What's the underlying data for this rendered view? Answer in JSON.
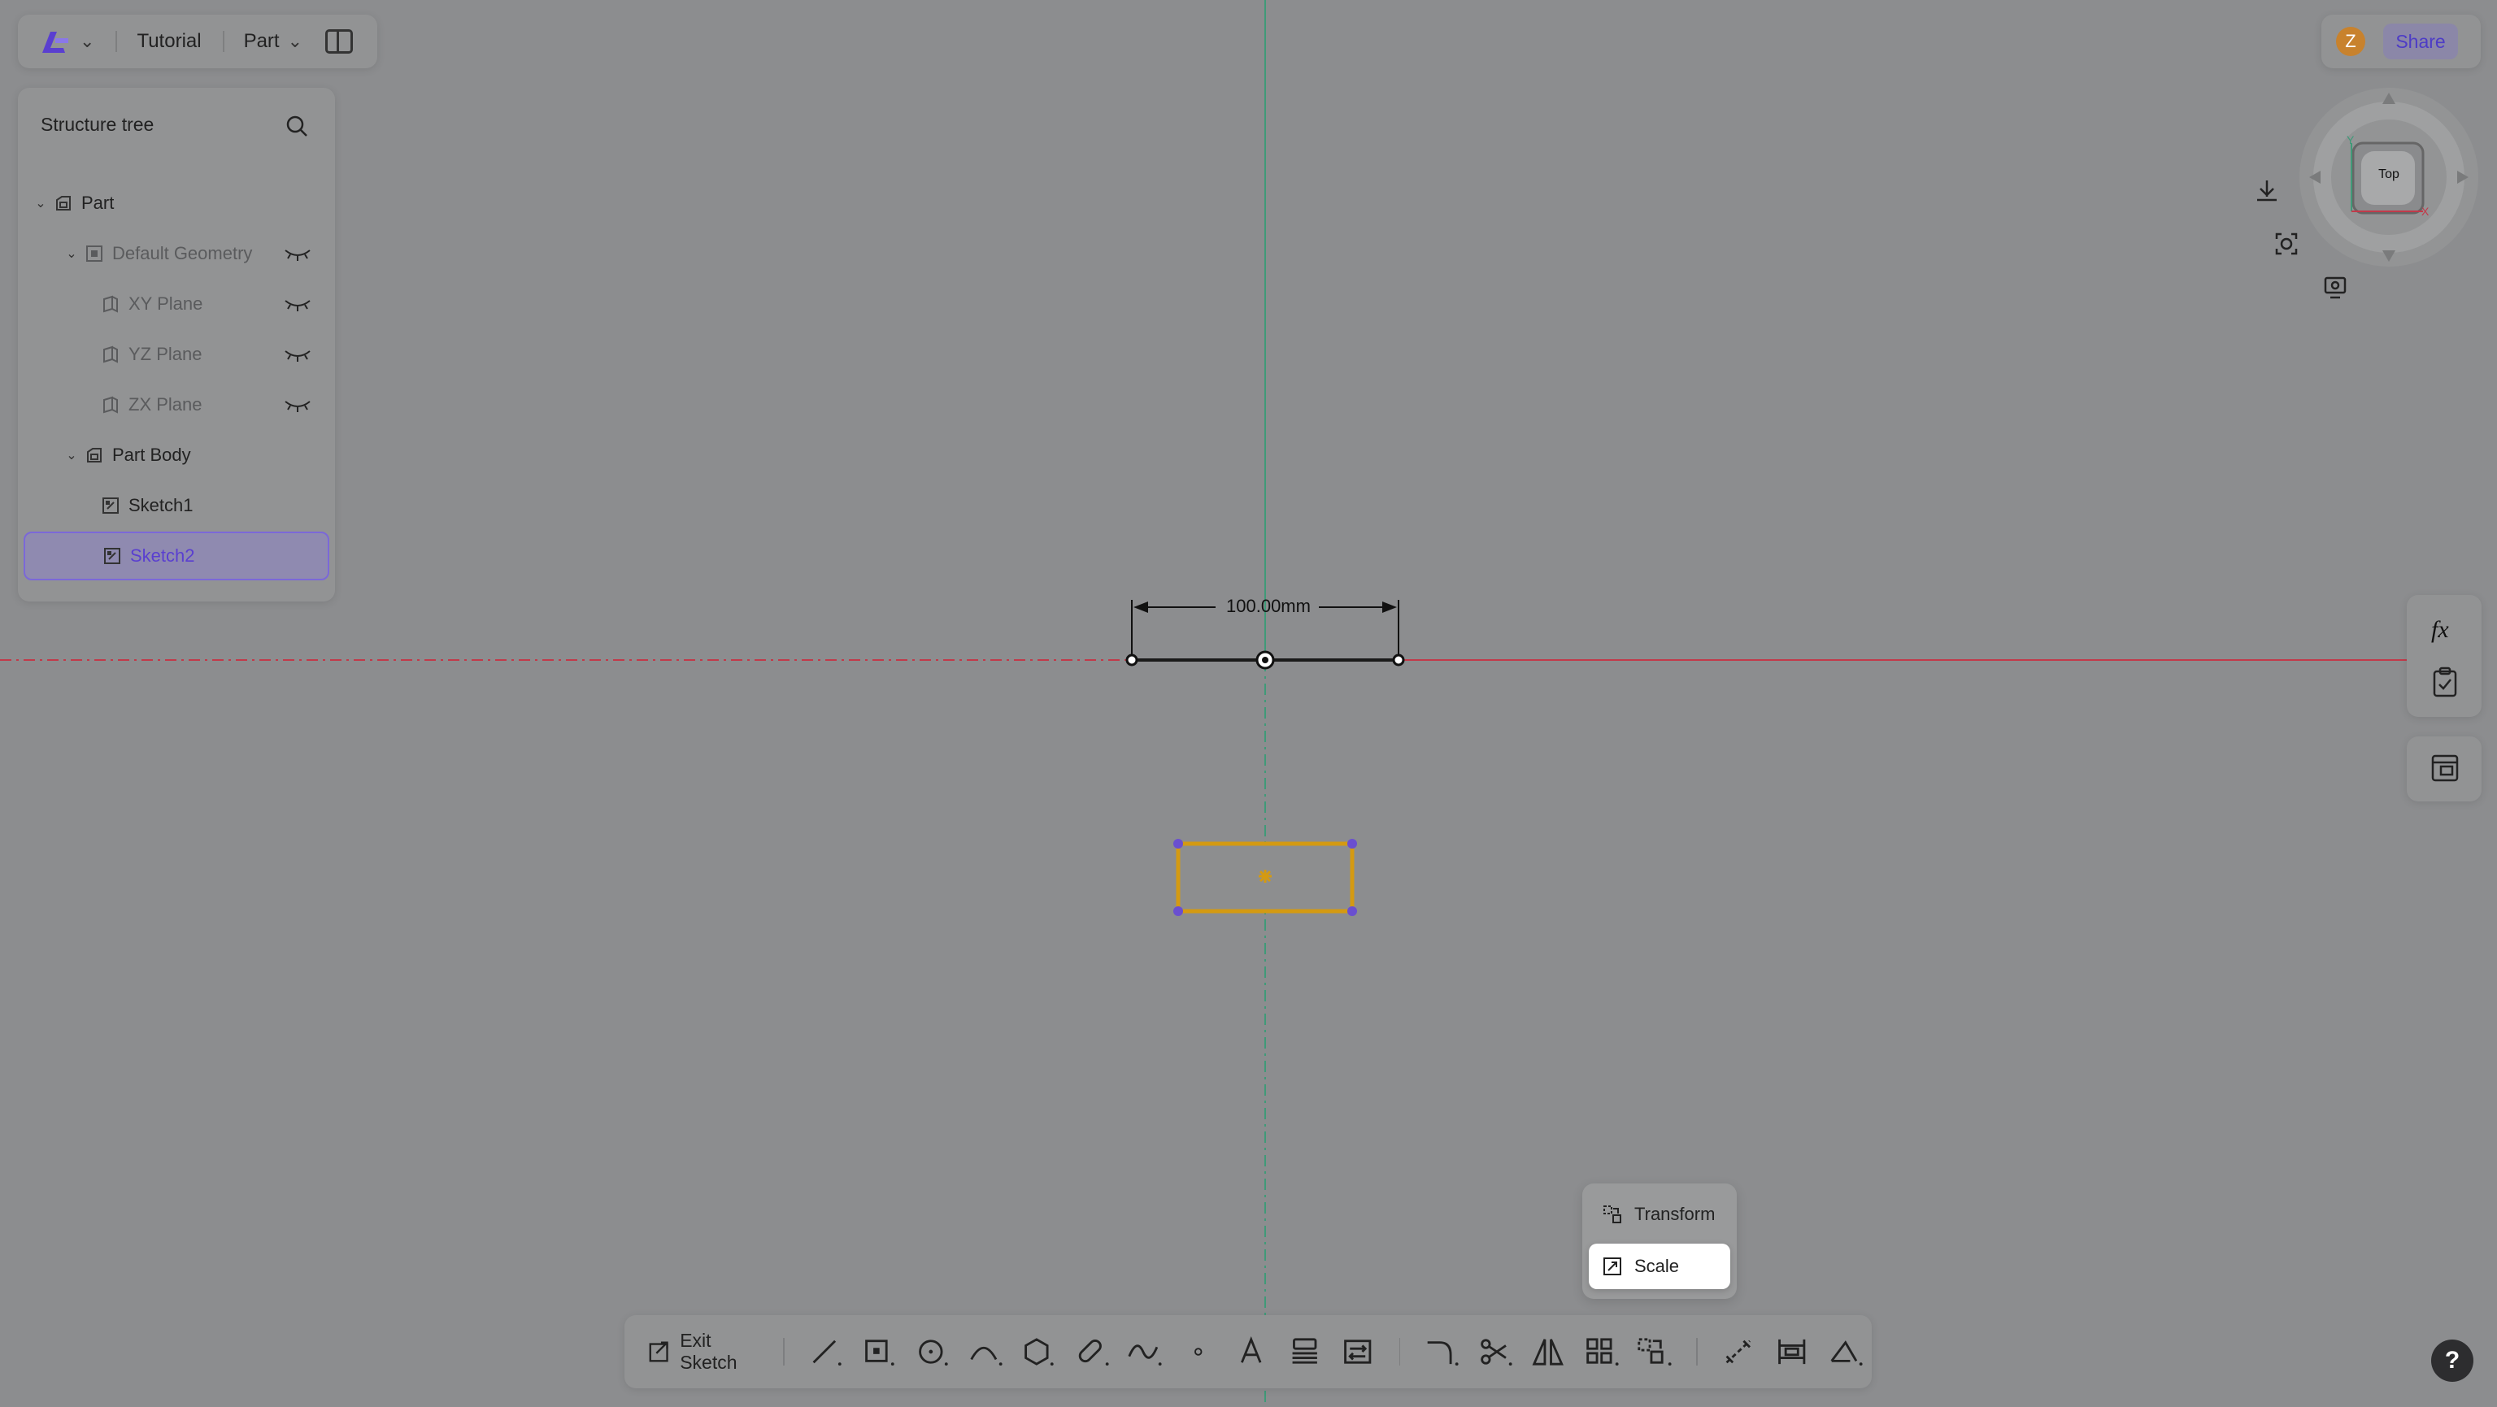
{
  "topbar": {
    "app_menu": "app-logo-menu",
    "project_name": "Tutorial",
    "part_label": "Part"
  },
  "tree": {
    "title": "Structure tree",
    "items": [
      {
        "label": "Part"
      },
      {
        "label": "Default Geometry"
      },
      {
        "label": "XY Plane"
      },
      {
        "label": "YZ Plane"
      },
      {
        "label": "ZX Plane"
      },
      {
        "label": "Part Body"
      },
      {
        "label": "Sketch1"
      },
      {
        "label": "Sketch2"
      }
    ]
  },
  "header_right": {
    "avatar_initial": "Z",
    "share_label": "Share"
  },
  "viewcube": {
    "face_label": "Top",
    "axis_y": "Y",
    "axis_x": "X"
  },
  "canvas": {
    "dimension_label": "100.00mm"
  },
  "popup": {
    "items": [
      {
        "label": "Transform",
        "icon": "transform-icon"
      },
      {
        "label": "Scale",
        "icon": "scale-icon"
      }
    ]
  },
  "toolbar": {
    "exit_label": "Exit Sketch"
  },
  "help": {
    "label": "?"
  },
  "colors": {
    "accent": "#5a3fd0",
    "x_axis": "#c23a4a",
    "y_axis": "#2f8f6f",
    "sketch_outline": "#d49a12"
  }
}
